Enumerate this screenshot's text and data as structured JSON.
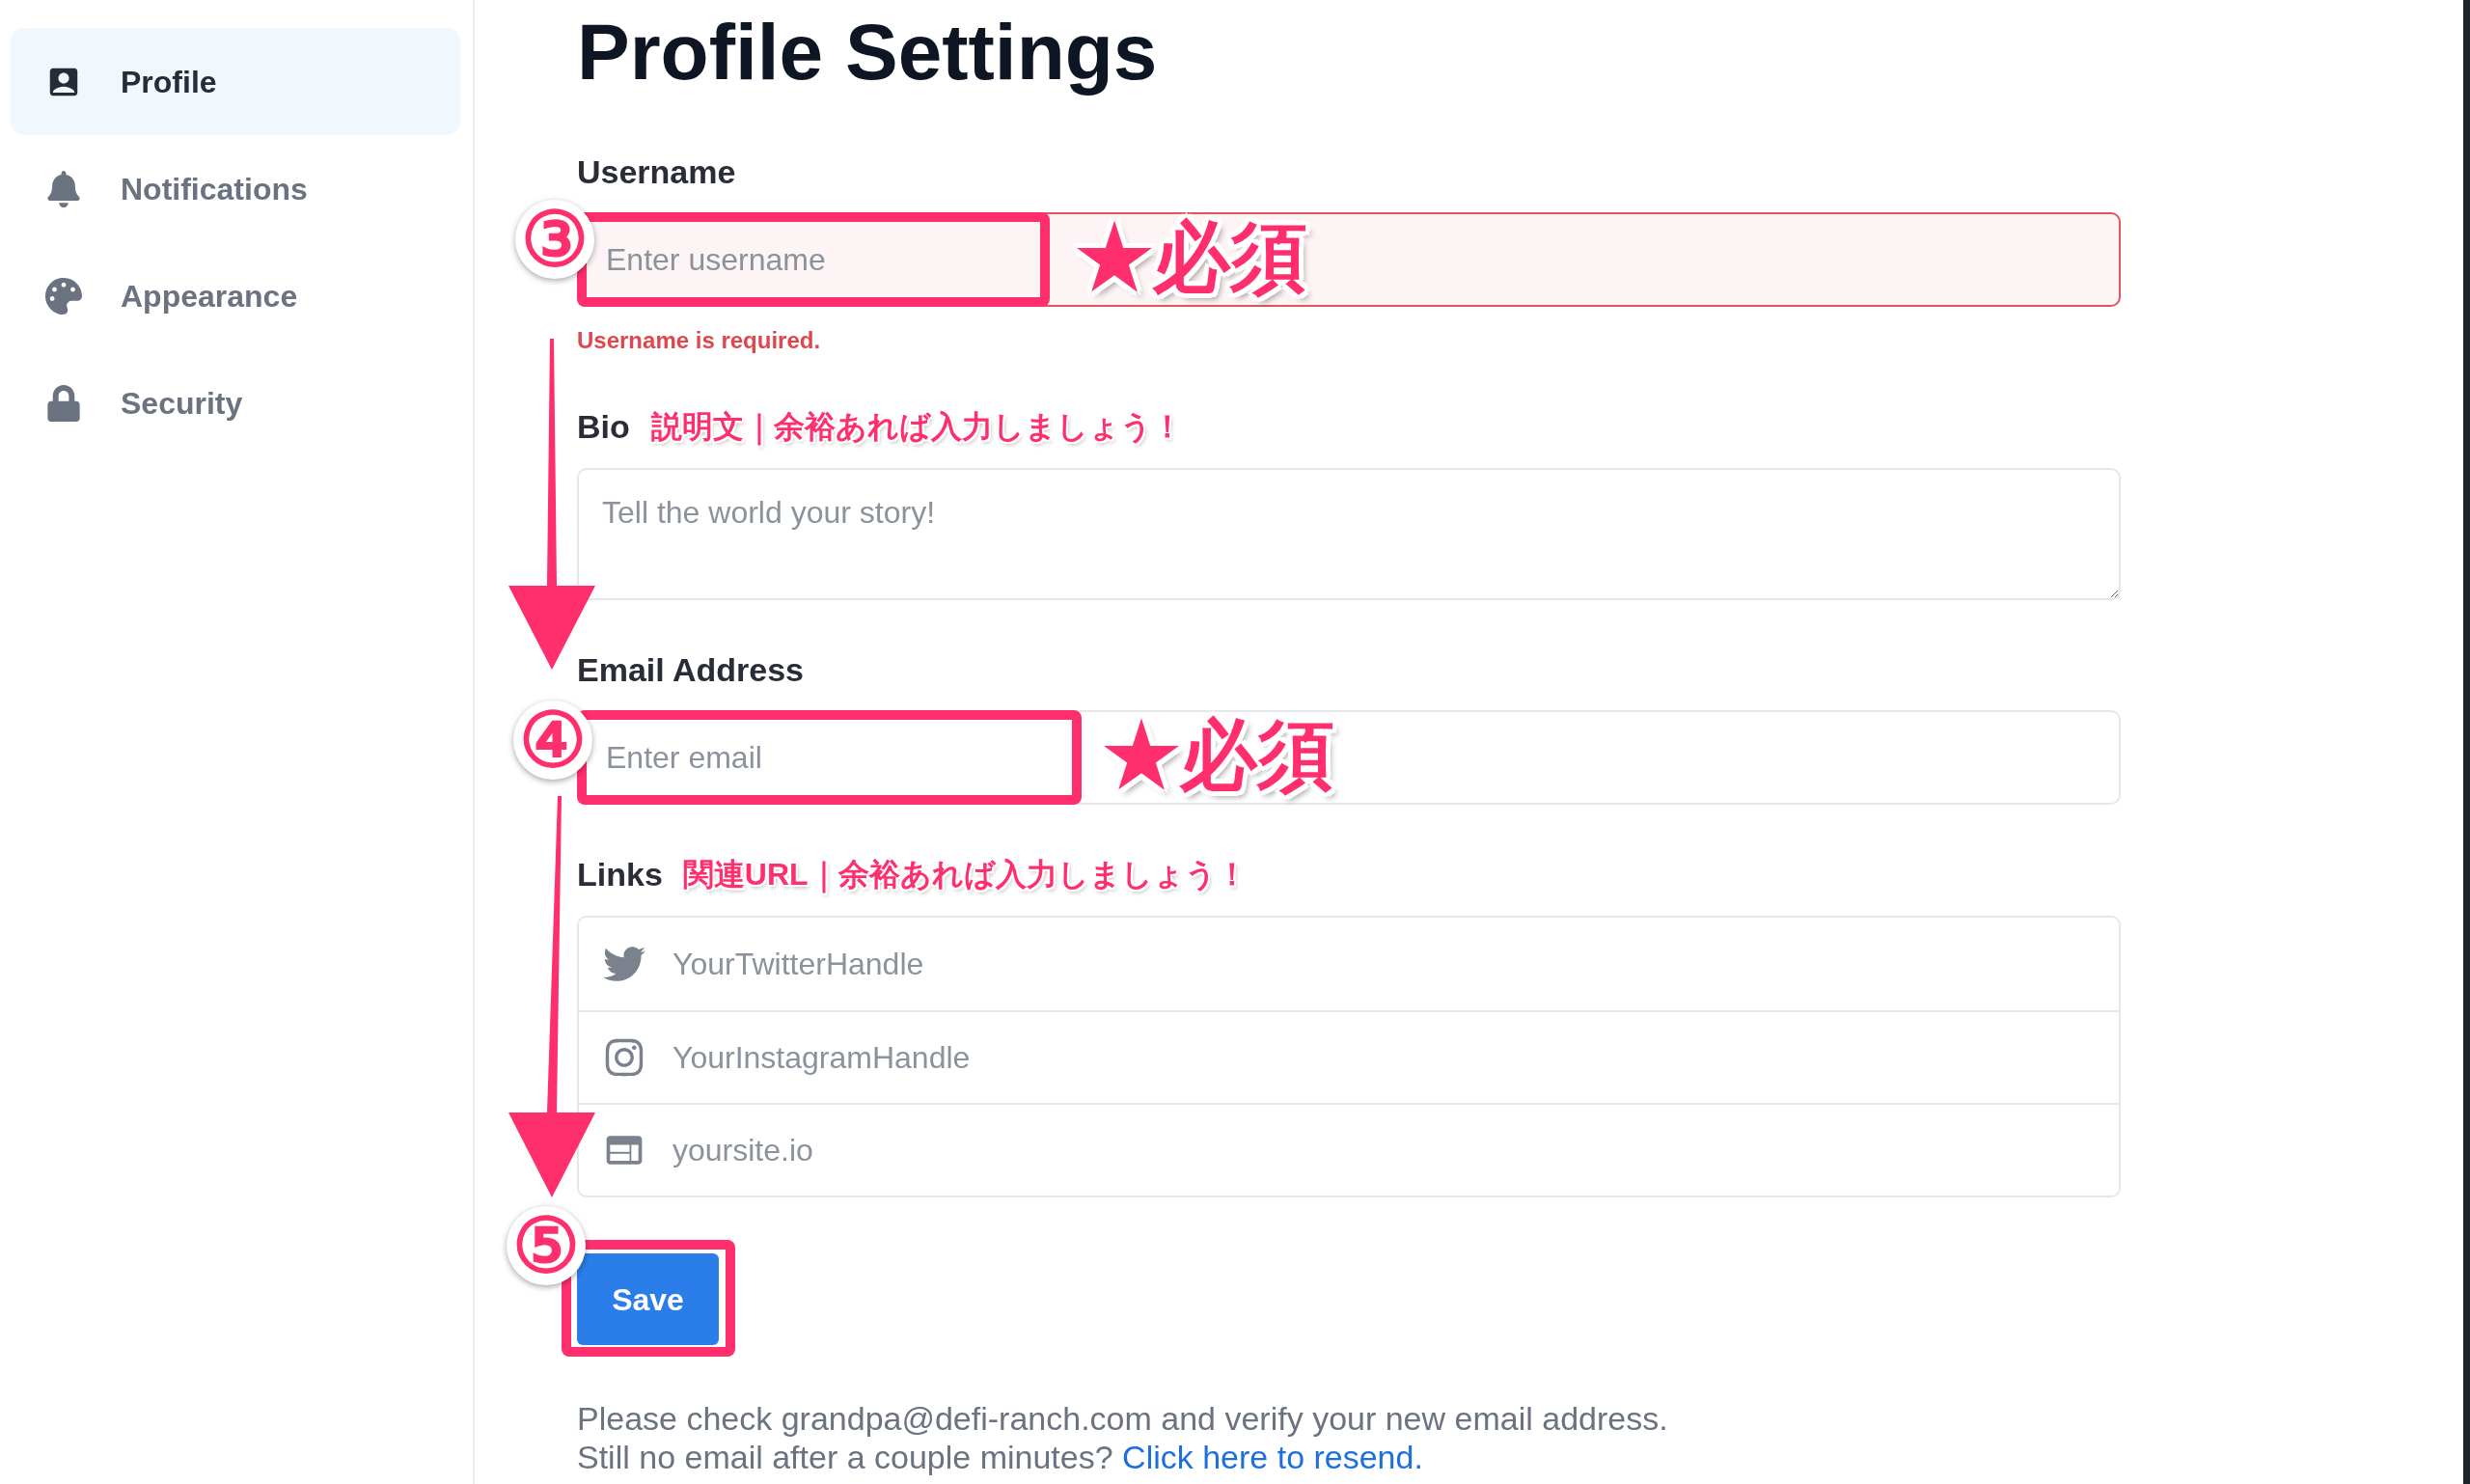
{
  "sidebar": {
    "items": [
      {
        "label": "Profile",
        "selected": true
      },
      {
        "label": "Notifications",
        "selected": false
      },
      {
        "label": "Appearance",
        "selected": false
      },
      {
        "label": "Security",
        "selected": false
      }
    ]
  },
  "title": "Profile Settings",
  "form": {
    "username": {
      "label": "Username",
      "placeholder": "Enter username",
      "invalid": true,
      "error": "Username is required.",
      "step": "③",
      "note": "★必須",
      "highlighted": true
    },
    "bio": {
      "label": "Bio",
      "note": "説明文｜余裕あれば入力しましょう！",
      "placeholder": "Tell the world your story!"
    },
    "email": {
      "label": "Email Address",
      "placeholder": "Enter email",
      "invalid": false,
      "step": "④",
      "note": "★必須",
      "highlighted": true
    },
    "links": {
      "label": "Links",
      "note": "関連URL｜余裕あれば入力しましょう！",
      "fields": [
        {
          "placeholder": "YourTwitterHandle"
        },
        {
          "placeholder": "YourInstagramHandle"
        },
        {
          "placeholder": "yoursite.io"
        }
      ]
    },
    "save": {
      "label": "Save",
      "step": "⑤",
      "highlighted": true
    },
    "notice": {
      "message": "Please check grandpa@defi-ranch.com and verify your new email address.",
      "prompt": "Still no email after a couple minutes?",
      "link": "Click here to resend."
    }
  }
}
